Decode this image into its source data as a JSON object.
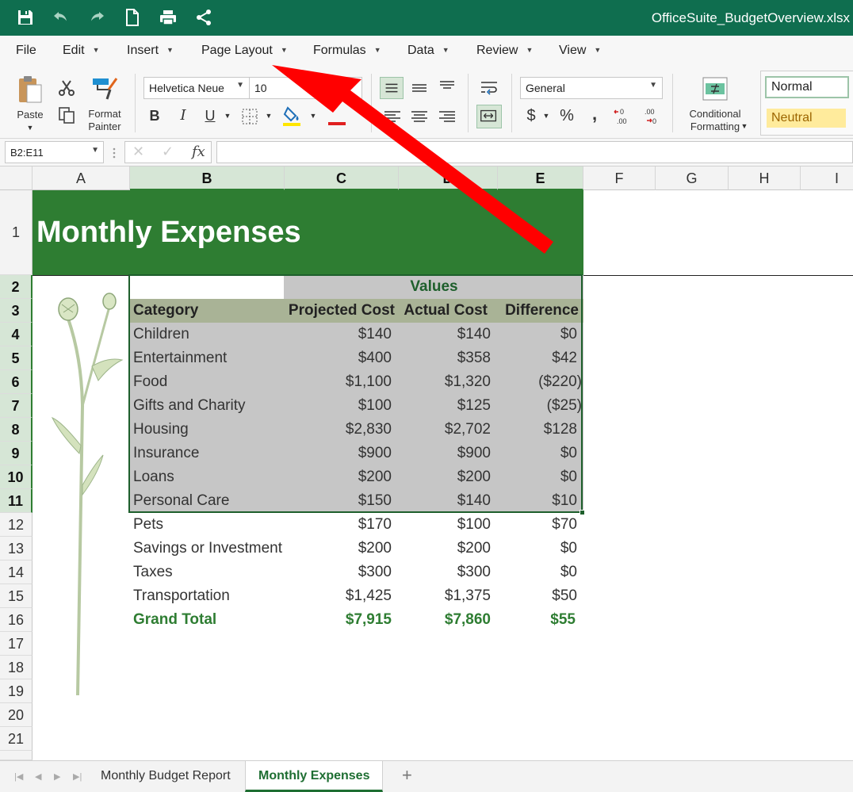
{
  "titlebar": {
    "file_title": "OfficeSuite_BudgetOverview.xlsx",
    "bg": "#0f6e4f"
  },
  "menu": [
    {
      "label": "File",
      "has_caret": false
    },
    {
      "label": "Edit",
      "has_caret": true
    },
    {
      "label": "Insert",
      "has_caret": true
    },
    {
      "label": "Page Layout",
      "has_caret": true
    },
    {
      "label": "Formulas",
      "has_caret": true
    },
    {
      "label": "Data",
      "has_caret": true
    },
    {
      "label": "Review",
      "has_caret": true
    },
    {
      "label": "View",
      "has_caret": true
    }
  ],
  "ribbon": {
    "paste_label": "Paste",
    "format_painter_label": "Format\nPainter",
    "font_name": "Helvetica Neue",
    "font_size": "10",
    "number_format": "General",
    "currency_symbol": "$",
    "percent_symbol": "%",
    "comma_symbol": ",",
    "conditional_formatting_label": "Conditional\nFormatting",
    "style_normal": "Normal",
    "style_neutral": "Neutral",
    "neutral_bg": "#ffeb9c",
    "increase_decimal": "←0\n.00",
    "decrease_decimal": ".00\n→0"
  },
  "formula_bar": {
    "name_box": "B2:E11",
    "fx_label": "fx",
    "formula": ""
  },
  "columns": [
    "A",
    "B",
    "C",
    "D",
    "E",
    "F",
    "G",
    "H",
    "I"
  ],
  "rows": [
    "1",
    "2",
    "3",
    "4",
    "5",
    "6",
    "7",
    "8",
    "9",
    "10",
    "11",
    "12",
    "13",
    "14",
    "15",
    "16",
    "17",
    "18",
    "19",
    "20",
    "21"
  ],
  "sheet": {
    "title": "Monthly Expenses",
    "title_bg": "#2e7d32",
    "values_header": "Values",
    "headers": [
      "Category",
      "Projected Cost",
      "Actual Cost",
      "Difference"
    ],
    "rows": [
      [
        "Children",
        "$140",
        "$140",
        "$0"
      ],
      [
        "Entertainment",
        "$400",
        "$358",
        "$42"
      ],
      [
        "Food",
        "$1,100",
        "$1,320",
        "($220)"
      ],
      [
        "Gifts and Charity",
        "$100",
        "$125",
        "($25)"
      ],
      [
        "Housing",
        "$2,830",
        "$2,702",
        "$128"
      ],
      [
        "Insurance",
        "$900",
        "$900",
        "$0"
      ],
      [
        "Loans",
        "$200",
        "$200",
        "$0"
      ],
      [
        "Personal Care",
        "$150",
        "$140",
        "$10"
      ],
      [
        "Pets",
        "$170",
        "$100",
        "$70"
      ],
      [
        "Savings or Investment",
        "$200",
        "$200",
        "$0"
      ],
      [
        "Taxes",
        "$300",
        "$300",
        "$0"
      ],
      [
        "Transportation",
        "$1,425",
        "$1,375",
        "$50"
      ]
    ],
    "total": [
      "Grand Total",
      "$7,915",
      "$7,860",
      "$55"
    ],
    "total_color": "#2e7d32"
  },
  "tabs": [
    {
      "label": "Monthly Budget Report",
      "active": false
    },
    {
      "label": "Monthly Expenses",
      "active": true
    }
  ],
  "add_sheet": "+",
  "annotation": {
    "type": "red-arrow",
    "color": "#ff0000",
    "points_to": "Page Layout"
  }
}
